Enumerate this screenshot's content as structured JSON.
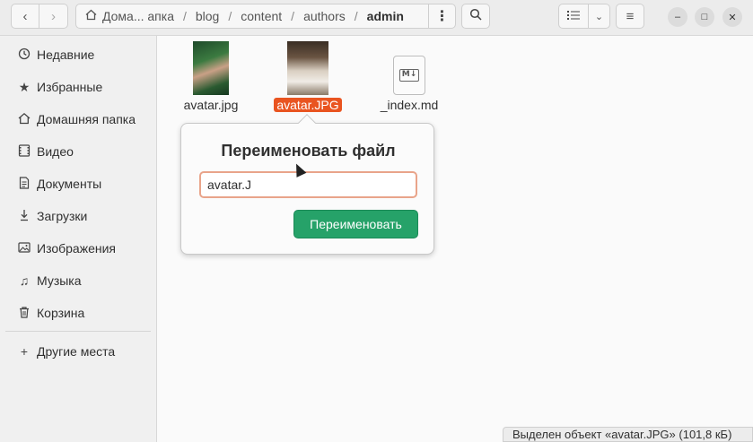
{
  "header": {
    "back_icon": "chevron-left-icon",
    "forward_icon": "chevron-right-icon",
    "breadcrumbs": [
      {
        "label": "Дома... апка"
      },
      {
        "label": "blog"
      },
      {
        "label": "content"
      },
      {
        "label": "authors"
      },
      {
        "label": "admin"
      }
    ]
  },
  "sidebar": {
    "items": [
      {
        "label": "Недавние",
        "icon": "clock-icon"
      },
      {
        "label": "Избранные",
        "icon": "star-icon"
      },
      {
        "label": "Домашняя папка",
        "icon": "home-icon"
      },
      {
        "label": "Видео",
        "icon": "video-icon"
      },
      {
        "label": "Документы",
        "icon": "document-icon"
      },
      {
        "label": "Загрузки",
        "icon": "download-icon"
      },
      {
        "label": "Изображения",
        "icon": "image-icon"
      },
      {
        "label": "Музыка",
        "icon": "music-icon"
      },
      {
        "label": "Корзина",
        "icon": "trash-icon"
      },
      {
        "label": "Другие места",
        "icon": "plus-icon"
      }
    ]
  },
  "files": [
    {
      "name": "avatar.jpg"
    },
    {
      "name": "avatar.JPG",
      "selected": true
    },
    {
      "name": "_index.md",
      "icon_text": "M↓"
    }
  ],
  "rename_popover": {
    "title": "Переименовать файл",
    "input_value": "avatar.J",
    "button_label": "Переименовать"
  },
  "status": {
    "text": "Выделен объект «avatar.JPG» (101,8 кБ)"
  },
  "colors": {
    "accent": "#e95420",
    "confirm": "#26a269"
  }
}
